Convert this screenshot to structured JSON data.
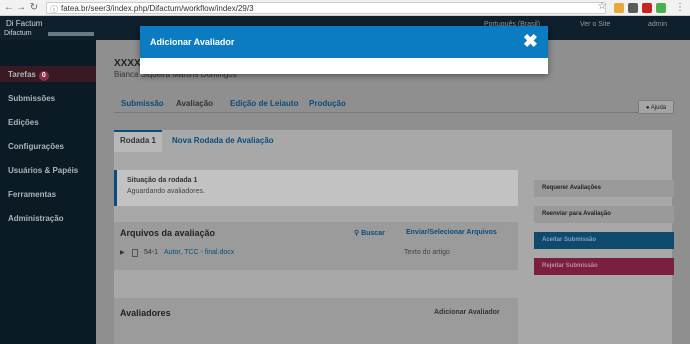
{
  "browser": {
    "url": "fatea.br/seer3/index.php/Difactum/workflow/index/29/3",
    "back_icon": "back-arrow-icon",
    "forward_icon": "forward-arrow-icon",
    "reload_icon": "reload-icon"
  },
  "header": {
    "site_name": "Di Factum",
    "breadcrumb": "Difactum",
    "language": "Português (Brasil)",
    "view_site": "Ver o Site",
    "user": "admin"
  },
  "sidebar": {
    "items": [
      {
        "label": "Tarefas",
        "badge": "0"
      },
      {
        "label": "Submissões"
      },
      {
        "label": "Edições"
      },
      {
        "label": "Configurações"
      },
      {
        "label": "Usuários & Papéis"
      },
      {
        "label": "Ferramentas"
      },
      {
        "label": "Administração"
      }
    ]
  },
  "submission": {
    "title_fragment": "XXXXX",
    "author": "Bianca Siqueira Martins Domingos"
  },
  "tabs": [
    "Submissão",
    "Avaliação",
    "Edição de Leiauto",
    "Produção"
  ],
  "help_label": "Ajuda",
  "round_tabs": [
    "Rodada 1",
    "Nova Rodada de Avaliação"
  ],
  "status": {
    "title": "Situação da rodada 1",
    "text": "Aguardando avaliadores."
  },
  "files": {
    "title": "Arquivos da avaliação",
    "search": "Buscar",
    "upload": "Enviar/Selecionar Arquivos",
    "row": {
      "id": "54-1",
      "name": "Autor, TCC - final.docx",
      "type": "Texto do artigo"
    }
  },
  "reviewers": {
    "title": "Avaliadores",
    "add": "Adicionar Avaliador"
  },
  "actions": [
    {
      "label": "Requerer Avaliações",
      "color": "#9a9a9a"
    },
    {
      "label": "Reenviar para Avaliação",
      "color": "#9a9a9a"
    },
    {
      "label": "Aceitar Submissão",
      "color": "#0d4a6e"
    },
    {
      "label": "Rejeitar Submissão",
      "color": "#7a1f3f"
    }
  ],
  "modal": {
    "title": "Adicionar Avaliador",
    "close_icon": "close-icon"
  },
  "colors": {
    "modal_header": "#0b7cc1",
    "sidebar": "#0b1b25",
    "link": "#0b4c7a"
  }
}
